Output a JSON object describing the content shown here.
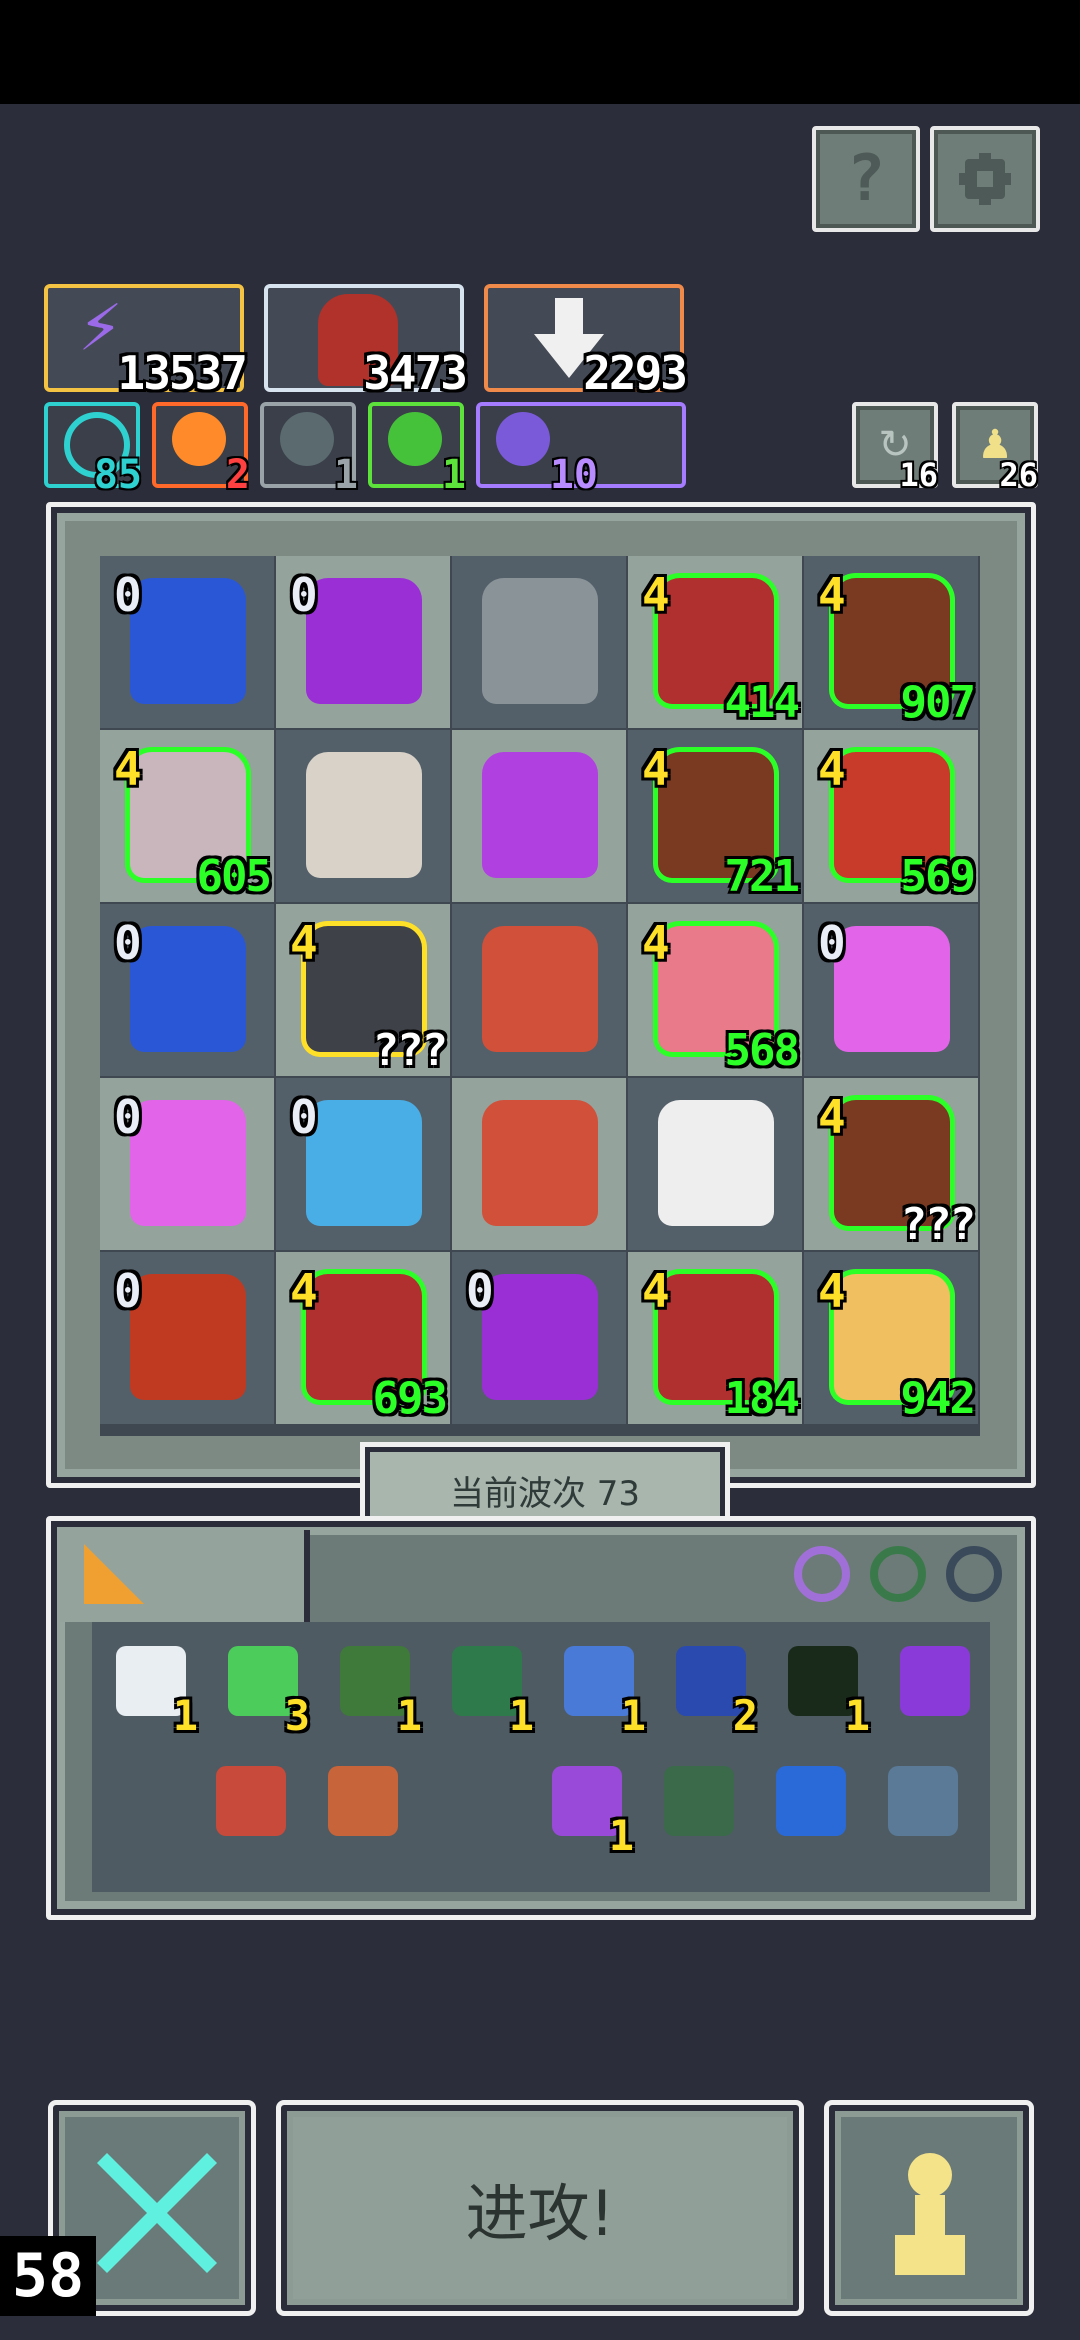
{
  "header": {
    "help_label": "?",
    "settings_icon": "gear-icon"
  },
  "resources": [
    {
      "name": "energy",
      "value": "13537",
      "icon": "lightning-icon",
      "border": "#f5c343"
    },
    {
      "name": "dragon",
      "value": "3473",
      "icon": "dragon-icon",
      "border": "#d8e3f0"
    },
    {
      "name": "pick",
      "value": "2293",
      "icon": "pickaxe-icon",
      "border": "#f08a4b"
    }
  ],
  "chips": [
    {
      "name": "spiral",
      "value": "85",
      "color": "#2fd0d0",
      "icon": "spiral-icon"
    },
    {
      "name": "fire",
      "value": "2",
      "color": "#ff6a2a",
      "icon": "fire-icon"
    },
    {
      "name": "wind",
      "value": "1",
      "color": "#9aa4a8",
      "icon": "wind-icon"
    },
    {
      "name": "poison",
      "value": "1",
      "color": "#5ce23a",
      "icon": "poison-icon"
    },
    {
      "name": "spark",
      "value": "10",
      "color": "#a57bff",
      "icon": "spark-icon"
    }
  ],
  "counters": [
    {
      "name": "refresh",
      "value": "16",
      "icon": "refresh-icon"
    },
    {
      "name": "pawn",
      "value": "26",
      "icon": "pawn-icon"
    }
  ],
  "board": [
    {
      "kind": "portal",
      "level": "0",
      "level_color": "w",
      "power": "",
      "tone": "dark",
      "color": "#2a57d6",
      "hl": ""
    },
    {
      "kind": "purple-dragon",
      "level": "0",
      "level_color": "w",
      "power": "",
      "tone": "light",
      "color": "#9a2fd6",
      "hl": ""
    },
    {
      "kind": "statue",
      "level": "",
      "level_color": "",
      "power": "",
      "tone": "dark",
      "color": "#8a9398",
      "hl": ""
    },
    {
      "kind": "knight",
      "level": "4",
      "level_color": "y",
      "power": "414",
      "tone": "light",
      "color": "#b03030",
      "hl": "g"
    },
    {
      "kind": "shield-knight",
      "level": "4",
      "level_color": "y",
      "power": "907",
      "tone": "dark",
      "color": "#7a3a22",
      "hl": "g"
    },
    {
      "kind": "maid",
      "level": "4",
      "level_color": "y",
      "power": "605",
      "tone": "light",
      "color": "#c8b6bc",
      "hl": "g"
    },
    {
      "kind": "skeleton-king",
      "level": "",
      "level_color": "",
      "power": "",
      "tone": "dark",
      "color": "#d8d2c8",
      "hl": ""
    },
    {
      "kind": "purple-demon",
      "level": "",
      "level_color": "",
      "power": "",
      "tone": "light",
      "color": "#b040e0",
      "hl": ""
    },
    {
      "kind": "shield-knight",
      "level": "4",
      "level_color": "y",
      "power": "721",
      "tone": "dark",
      "color": "#7a3a22",
      "hl": "g"
    },
    {
      "kind": "viking",
      "level": "4",
      "level_color": "y",
      "power": "569",
      "tone": "light",
      "color": "#c83a2a",
      "hl": "g"
    },
    {
      "kind": "portal",
      "level": "0",
      "level_color": "w",
      "power": "",
      "tone": "dark",
      "color": "#2a57d6",
      "hl": ""
    },
    {
      "kind": "dark-knight",
      "level": "4",
      "level_color": "y",
      "power": "???",
      "tone": "light",
      "color": "#3e4148",
      "hl": "y"
    },
    {
      "kind": "crystal",
      "level": "",
      "level_color": "",
      "power": "",
      "tone": "dark",
      "color": "#d0503a",
      "hl": ""
    },
    {
      "kind": "archer-girl",
      "level": "4",
      "level_color": "y",
      "power": "568",
      "tone": "light",
      "color": "#e87a8a",
      "hl": "g"
    },
    {
      "kind": "pink-demon",
      "level": "0",
      "level_color": "w",
      "power": "",
      "tone": "dark",
      "color": "#e264e8",
      "hl": ""
    },
    {
      "kind": "pink-demon",
      "level": "0",
      "level_color": "w",
      "power": "",
      "tone": "light",
      "color": "#e264e8",
      "hl": ""
    },
    {
      "kind": "ice-demon",
      "level": "0",
      "level_color": "w",
      "power": "",
      "tone": "dark",
      "color": "#4aaee6",
      "hl": ""
    },
    {
      "kind": "crystal",
      "level": "",
      "level_color": "",
      "power": "",
      "tone": "light",
      "color": "#d0503a",
      "hl": ""
    },
    {
      "kind": "ghost",
      "level": "",
      "level_color": "",
      "power": "",
      "tone": "dark",
      "color": "#eeeeee",
      "hl": ""
    },
    {
      "kind": "shield-knight",
      "level": "4",
      "level_color": "y",
      "power": "???",
      "tone": "light",
      "color": "#7a3a22",
      "hl": "g"
    },
    {
      "kind": "red-dragon",
      "level": "0",
      "level_color": "w",
      "power": "",
      "tone": "dark",
      "color": "#c03a22",
      "hl": ""
    },
    {
      "kind": "knight",
      "level": "4",
      "level_color": "y",
      "power": "693",
      "tone": "light",
      "color": "#b03030",
      "hl": "g"
    },
    {
      "kind": "purple-dragon",
      "level": "0",
      "level_color": "w",
      "power": "",
      "tone": "dark",
      "color": "#9a2fd6",
      "hl": ""
    },
    {
      "kind": "knight",
      "level": "4",
      "level_color": "y",
      "power": "184",
      "tone": "light",
      "color": "#b03030",
      "hl": "g"
    },
    {
      "kind": "mage-girl",
      "level": "4",
      "level_color": "y",
      "power": "942",
      "tone": "dark",
      "color": "#f0c060",
      "hl": "g"
    }
  ],
  "wave_label": "当前波次 73",
  "inventory": {
    "tab_icon": "cheese-icon",
    "ring_icons": [
      "purple-ring-icon",
      "green-ring-icon",
      "dark-ring-icon"
    ],
    "row1": [
      {
        "name": "scroll",
        "count": "1",
        "color": "#e8eef2"
      },
      {
        "name": "gem-shield",
        "count": "3",
        "color": "#4ccc5a"
      },
      {
        "name": "hooded-figure",
        "count": "1",
        "color": "#3f7a3a"
      },
      {
        "name": "goblin",
        "count": "1",
        "color": "#2f7a4a"
      },
      {
        "name": "axe",
        "count": "1",
        "color": "#4a7ad8"
      },
      {
        "name": "hourglass",
        "count": "2",
        "color": "#2a4ab0"
      },
      {
        "name": "demon-mask",
        "count": "1",
        "color": "#1a2a1a"
      },
      {
        "name": "magic-wand",
        "count": "",
        "color": "#8a3ad8"
      }
    ],
    "row2": [
      {
        "name": "red-leaves",
        "count": "",
        "color": "#c84a3a"
      },
      {
        "name": "feather",
        "count": "",
        "color": "#c8643a"
      },
      {
        "name": "potion",
        "count": "1",
        "color": "#9a4ad8"
      },
      {
        "name": "green-crystal",
        "count": "",
        "color": "#3a6a4a"
      },
      {
        "name": "blue-wave",
        "count": "",
        "color": "#2a6ad8"
      },
      {
        "name": "ice-claws",
        "count": "",
        "color": "#5a7a98"
      }
    ]
  },
  "actions": {
    "battle_icon": "crossed-swords-icon",
    "attack_label": "进攻!",
    "pawn_icon": "pawn-icon"
  },
  "fps": "58"
}
